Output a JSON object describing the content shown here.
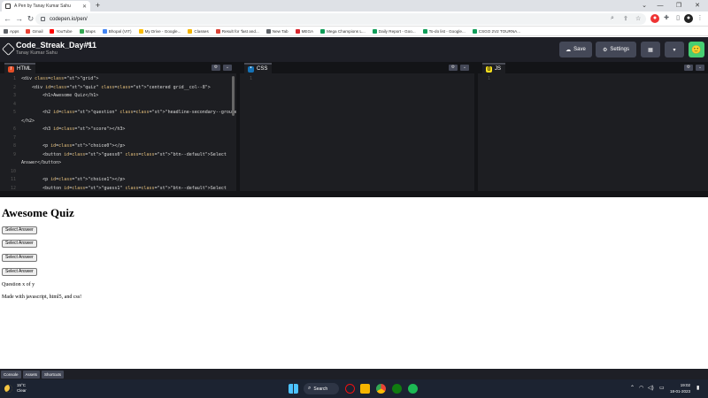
{
  "browser": {
    "tab_title": "A Pen by Tanay Kumar Sahu",
    "url": "codepen.io/pen/",
    "bookmarks": [
      {
        "label": "Apps",
        "color": "#5f6368"
      },
      {
        "label": "Gmail",
        "color": "#ea4335"
      },
      {
        "label": "YouTube",
        "color": "#ff0000"
      },
      {
        "label": "Maps",
        "color": "#34a853"
      },
      {
        "label": "Bhopal (VIT)",
        "color": "#4285f4"
      },
      {
        "label": "My Drive - Google...",
        "color": "#fbbc04"
      },
      {
        "label": "Classes",
        "color": "#f4b400"
      },
      {
        "label": "Result for 'fast and...",
        "color": "#db4437"
      },
      {
        "label": "New Tab",
        "color": "#5f6368"
      },
      {
        "label": "MEGA",
        "color": "#d9272e"
      },
      {
        "label": "Mega Champions L...",
        "color": "#0f9d58"
      },
      {
        "label": "Daily Report - Goo...",
        "color": "#0f9d58"
      },
      {
        "label": "To-do list - Google...",
        "color": "#0f9d58"
      },
      {
        "label": "CSGO 2V2 TOURNA...",
        "color": "#0f9d58"
      }
    ]
  },
  "codepen": {
    "pen_title": "Code_Streak_Day#11",
    "author": "Tanay Kumar Sahu",
    "save_label": "Save",
    "settings_label": "Settings",
    "panes": {
      "html": "HTML",
      "css": "CSS",
      "js": "JS"
    },
    "html_code": [
      {
        "n": "1",
        "text": "<div class=\"grid\">"
      },
      {
        "n": "2",
        "text": "    <div id=\"quiz\" class=\"centered grid__col--8\">"
      },
      {
        "n": "3",
        "text": "        <h1>Awesome Quiz</h1>"
      },
      {
        "n": "4",
        "text": ""
      },
      {
        "n": "5",
        "text": "        <h2 id=\"question\" class=\"headline-secondary--grouped\">"
      },
      {
        "n": "",
        "text": "</h2>"
      },
      {
        "n": "6",
        "text": "        <h3 id=\"score\"></h3>"
      },
      {
        "n": "7",
        "text": ""
      },
      {
        "n": "8",
        "text": "        <p id=\"choice0\"></p>"
      },
      {
        "n": "9",
        "text": "        <button id=\"guess0\" class=\"btn--default\">Select"
      },
      {
        "n": "",
        "text": "Answer</button>"
      },
      {
        "n": "10",
        "text": ""
      },
      {
        "n": "11",
        "text": "        <p id=\"choice1\"></p>"
      },
      {
        "n": "12",
        "text": "        <button id=\"guess1\" class=\"btn--default\">Select"
      }
    ],
    "css_line": "1",
    "js_line": "1",
    "footer": {
      "console": "Console",
      "assets": "Assets",
      "shortcuts": "Shortcuts"
    }
  },
  "preview": {
    "heading": "Awesome Quiz",
    "buttons": [
      "Select Answer",
      "Select Answer",
      "Select Answer",
      "Select Answer"
    ],
    "progress": "Question x of y",
    "footer_text": "Made with javascript, html5, and css!"
  },
  "taskbar": {
    "temp": "15°C",
    "condition": "Clear",
    "search_label": "Search",
    "time": "19:02",
    "date": "18-01-2023"
  }
}
